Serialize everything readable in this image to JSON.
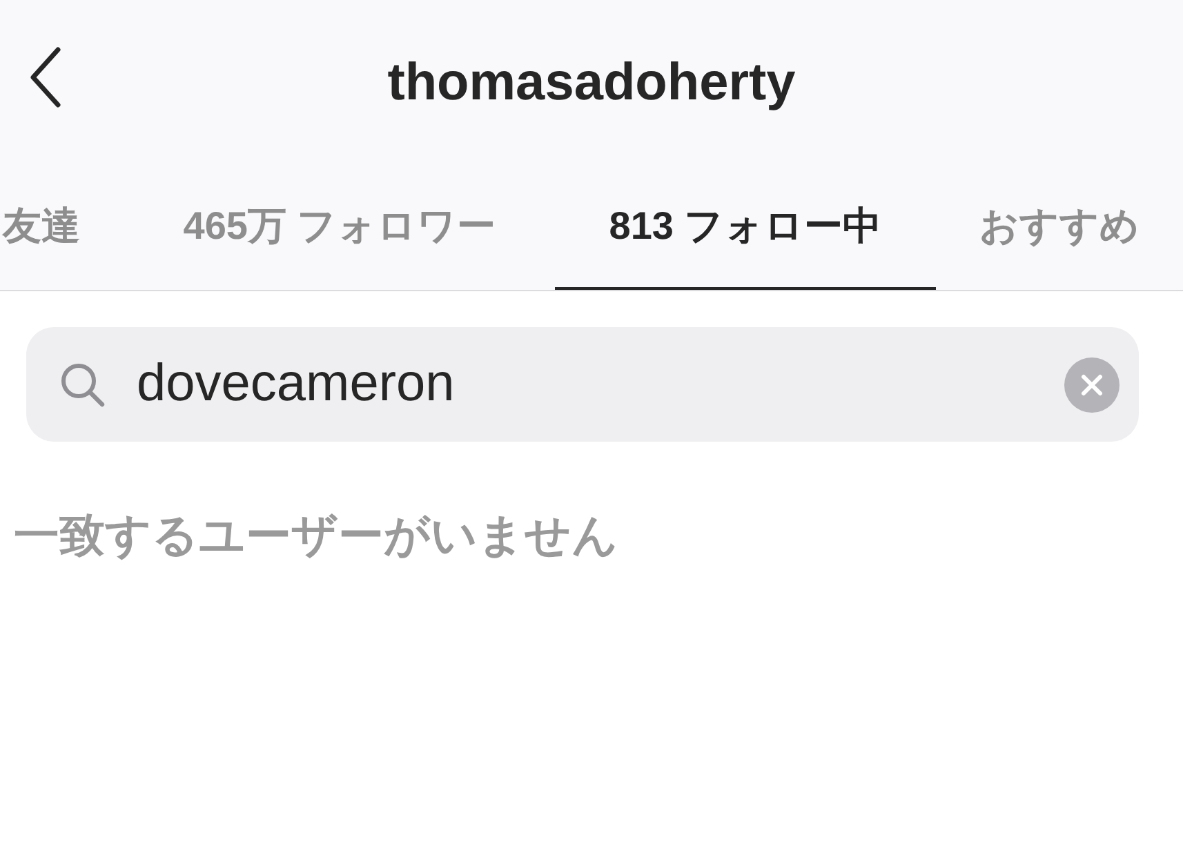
{
  "header": {
    "title": "thomasadoherty"
  },
  "tabs": [
    {
      "label": "友達",
      "selected": false
    },
    {
      "label": "465万 フォロワー",
      "selected": false
    },
    {
      "label": "813 フォロー中",
      "selected": true
    },
    {
      "label": "おすすめ",
      "selected": false
    }
  ],
  "search": {
    "value": "dovecameron"
  },
  "empty_message": "一致するユーザーがいません"
}
